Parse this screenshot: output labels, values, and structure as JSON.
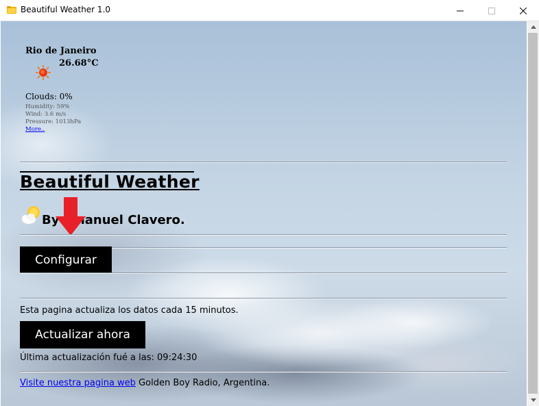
{
  "window": {
    "title": "Beautiful Weather 1.0",
    "app_icon": "folder-weather-icon",
    "controls": [
      "minimize-icon",
      "maximize-icon",
      "close-icon"
    ]
  },
  "weather": {
    "city": "Rio de Janeiro",
    "temperature": "26.68°C",
    "condition_icon": "sun-icon",
    "clouds": "Clouds: 0%",
    "humidity": "Humidity: 59%",
    "wind": "Wind: 3.6 m/s",
    "pressure": "Pressure: 1013hPa",
    "more_link": "More.."
  },
  "header": {
    "title": "Beautiful Weather",
    "logo_icon": "partly-cloudy-icon",
    "author": "By Emanuel Clavero."
  },
  "annotation": {
    "arrow_icon": "red-down-arrow-icon",
    "color": "#e8202a"
  },
  "config": {
    "button_label": "Configurar"
  },
  "refresh": {
    "info": "Esta pagina actualiza los datos cada 15 minutos.",
    "button_label": "Actualizar ahora",
    "last_update": "Última actualización fué a las: 09:24:30"
  },
  "footer": {
    "link_text": "Visite nuestra pagina web",
    "suffix": " Golden Boy Radio, Argentina."
  },
  "colors": {
    "button_bg": "#000000",
    "button_text": "#ffffff",
    "link": "#0000ee",
    "sky": "#c3d4e4"
  }
}
